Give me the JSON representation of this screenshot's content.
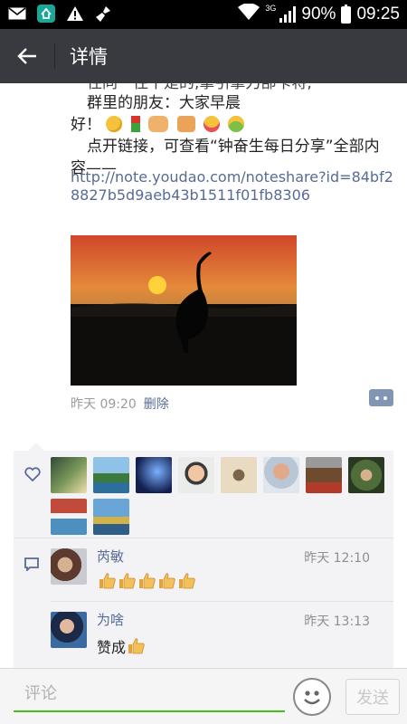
{
  "status_bar": {
    "network": "3G",
    "battery": "90%",
    "time": "09:25",
    "icons": [
      "mail-icon",
      "huawei-app-icon",
      "warning-icon",
      "cleaner-icon",
      "wifi-icon",
      "signal-icon",
      "battery-icon"
    ]
  },
  "header": {
    "title": "详情",
    "back_icon": "arrow-left-icon"
  },
  "post": {
    "partial_first_line": "往同一往干是的,拿引擎刀部卡将,",
    "line2": "群里的朋友：大家早晨",
    "line3_prefix": "好！",
    "line4": "点开链接，可查看“钟奋生每日分享”全部内",
    "line5": "容——",
    "link": "http://note.youdao.com/noteshare?id=84bf28827b5d9aeb43b1511f01fb8306",
    "time": "昨天 09:20",
    "delete": "删除",
    "emojis": [
      "smile-emoji",
      "rose-emoji",
      "handshake-emoji",
      "fist-bump-emoji",
      "wink-tongue-emoji",
      "hug-emoji"
    ]
  },
  "likes": {
    "icon": "heart-outline-icon",
    "avatar_count": 10
  },
  "comments": [
    {
      "name": "芮敏",
      "time": "昨天 12:10",
      "text": "",
      "thumbs": 5
    },
    {
      "name": "为啥",
      "time": "昨天 13:13",
      "text": "赞成",
      "thumbs": 1
    }
  ],
  "composer": {
    "placeholder": "评论",
    "send": "发送"
  },
  "colors": {
    "title_bar": "#393a3f",
    "link": "#576b95",
    "accent_green": "#45c01a",
    "panel": "#f3f3f5"
  }
}
